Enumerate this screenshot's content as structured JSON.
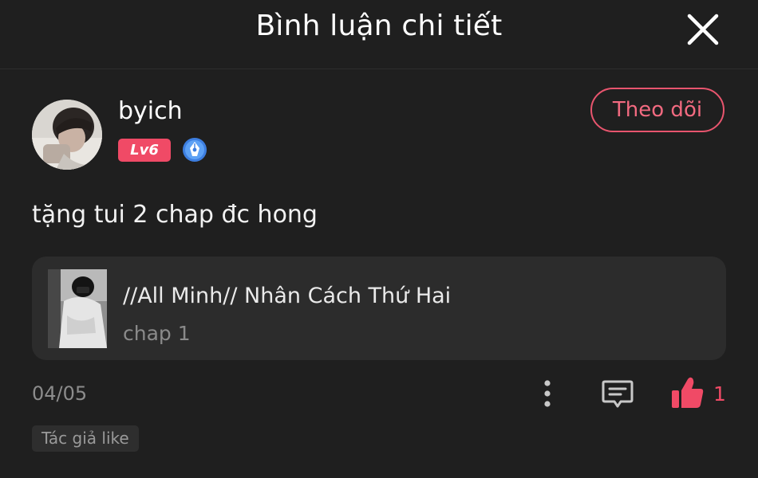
{
  "header": {
    "title": "Bình luận chi tiết",
    "close_icon": "close-icon"
  },
  "user": {
    "name": "byich",
    "level": "Lv6",
    "level_color": "#f04a66",
    "verified_icon": "pen-badge-icon",
    "follow_label": "Theo dõi",
    "follow_color": "#e8556e"
  },
  "comment": {
    "text": "tặng tui 2 chap đc hong"
  },
  "comic": {
    "title": "//All Minh// Nhân Cách Thứ Hai",
    "chapter": "chap 1"
  },
  "footer": {
    "date": "04/05",
    "more_icon": "more-vertical-icon",
    "reply_icon": "comment-icon",
    "like_icon": "thumbs-up-icon",
    "like_count": "1",
    "author_like_tag": "Tác giả like"
  }
}
